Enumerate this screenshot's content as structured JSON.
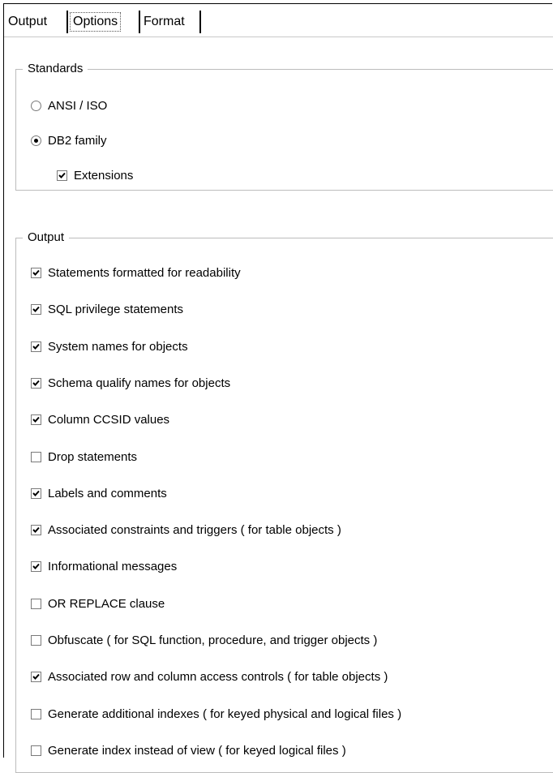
{
  "tabs": [
    {
      "label": "Output",
      "active": false
    },
    {
      "label": "Options",
      "active": true
    },
    {
      "label": "Format",
      "active": false
    }
  ],
  "standards": {
    "legend": "Standards",
    "ansi_label": "ANSI / ISO",
    "ansi_selected": false,
    "db2_label": "DB2 family",
    "db2_selected": true,
    "extensions_label": "Extensions",
    "extensions_checked": true
  },
  "output": {
    "legend": "Output",
    "items": [
      {
        "label": "Statements formatted for readability",
        "checked": true
      },
      {
        "label": "SQL privilege statements",
        "checked": true
      },
      {
        "label": "System names for objects",
        "checked": true
      },
      {
        "label": "Schema qualify names for objects",
        "checked": true
      },
      {
        "label": "Column CCSID values",
        "checked": true
      },
      {
        "label": "Drop statements",
        "checked": false
      },
      {
        "label": "Labels and comments",
        "checked": true
      },
      {
        "label": "Associated constraints and triggers ( for table objects )",
        "checked": true
      },
      {
        "label": "Informational messages",
        "checked": true
      },
      {
        "label": "OR REPLACE clause",
        "checked": false
      },
      {
        "label": "Obfuscate ( for SQL function, procedure, and trigger objects )",
        "checked": false
      },
      {
        "label": "Associated row and column access controls ( for table objects )",
        "checked": true
      },
      {
        "label": "Generate additional indexes ( for keyed physical and logical files )",
        "checked": false
      },
      {
        "label": "Generate index instead of view ( for keyed logical files )",
        "checked": false
      }
    ]
  }
}
